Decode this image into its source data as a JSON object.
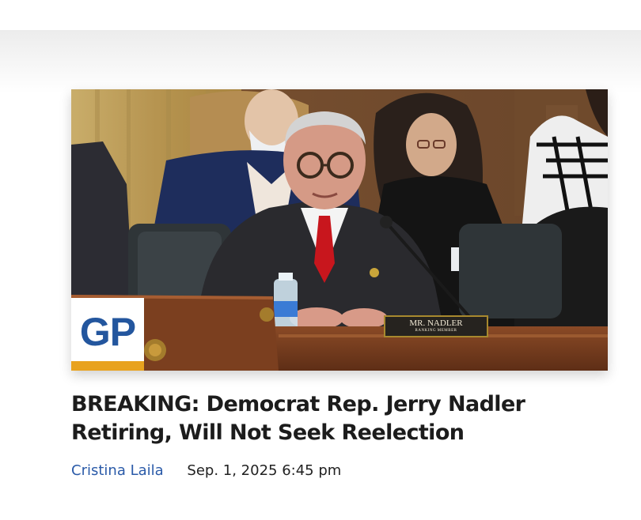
{
  "article": {
    "headline_line1": "BREAKING: Democrat Rep. Jerry Nadler",
    "headline_line2": "Retiring, Will Not Seek Reelection",
    "author": "Cristina Laila",
    "date": "Sep. 1, 2025 6:45 pm",
    "image": {
      "logo_text": "GP",
      "nameplate_name": "MR. NADLER",
      "nameplate_role": "RANKING MEMBER"
    }
  },
  "colors": {
    "author_link": "#2a5aa8",
    "headline": "#1c1c1c",
    "logo_blue": "#23569e",
    "logo_accent": "#e8a21e"
  }
}
